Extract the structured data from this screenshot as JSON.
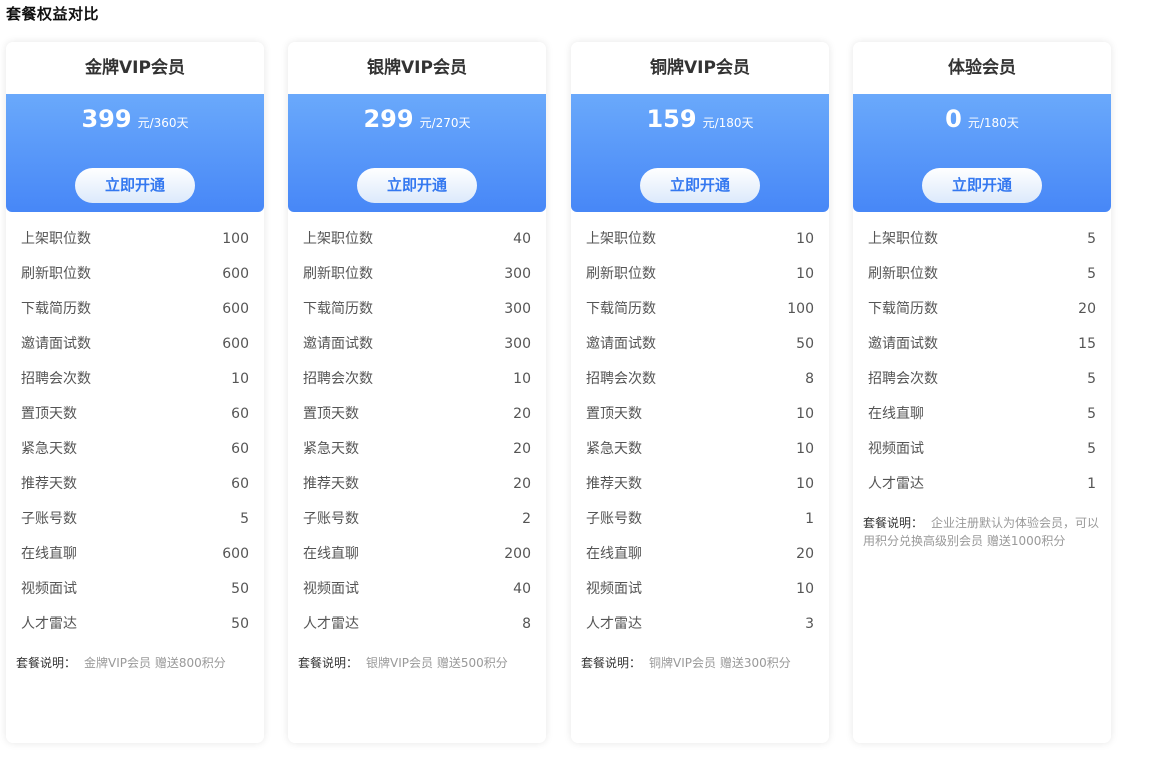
{
  "page_title": "套餐权益对比",
  "plans": [
    {
      "name": "金牌VIP会员",
      "price": "399",
      "unit": "元/360天",
      "button": "立即开通",
      "features": [
        {
          "label": "上架职位数",
          "value": "100"
        },
        {
          "label": "刷新职位数",
          "value": "600"
        },
        {
          "label": "下载简历数",
          "value": "600"
        },
        {
          "label": "邀请面试数",
          "value": "600"
        },
        {
          "label": "招聘会次数",
          "value": "10"
        },
        {
          "label": "置顶天数",
          "value": "60"
        },
        {
          "label": "紧急天数",
          "value": "60"
        },
        {
          "label": "推荐天数",
          "value": "60"
        },
        {
          "label": "子账号数",
          "value": "5"
        },
        {
          "label": "在线直聊",
          "value": "600"
        },
        {
          "label": "视频面试",
          "value": "50"
        },
        {
          "label": "人才雷达",
          "value": "50"
        }
      ],
      "note_label": "套餐说明：",
      "note_text": "金牌VIP会员 赠送800积分"
    },
    {
      "name": "银牌VIP会员",
      "price": "299",
      "unit": "元/270天",
      "button": "立即开通",
      "features": [
        {
          "label": "上架职位数",
          "value": "40"
        },
        {
          "label": "刷新职位数",
          "value": "300"
        },
        {
          "label": "下载简历数",
          "value": "300"
        },
        {
          "label": "邀请面试数",
          "value": "300"
        },
        {
          "label": "招聘会次数",
          "value": "10"
        },
        {
          "label": "置顶天数",
          "value": "20"
        },
        {
          "label": "紧急天数",
          "value": "20"
        },
        {
          "label": "推荐天数",
          "value": "20"
        },
        {
          "label": "子账号数",
          "value": "2"
        },
        {
          "label": "在线直聊",
          "value": "200"
        },
        {
          "label": "视频面试",
          "value": "40"
        },
        {
          "label": "人才雷达",
          "value": "8"
        }
      ],
      "note_label": "套餐说明：",
      "note_text": "银牌VIP会员 赠送500积分"
    },
    {
      "name": "铜牌VIP会员",
      "price": "159",
      "unit": "元/180天",
      "button": "立即开通",
      "features": [
        {
          "label": "上架职位数",
          "value": "10"
        },
        {
          "label": "刷新职位数",
          "value": "10"
        },
        {
          "label": "下载简历数",
          "value": "100"
        },
        {
          "label": "邀请面试数",
          "value": "50"
        },
        {
          "label": "招聘会次数",
          "value": "8"
        },
        {
          "label": "置顶天数",
          "value": "10"
        },
        {
          "label": "紧急天数",
          "value": "10"
        },
        {
          "label": "推荐天数",
          "value": "10"
        },
        {
          "label": "子账号数",
          "value": "1"
        },
        {
          "label": "在线直聊",
          "value": "20"
        },
        {
          "label": "视频面试",
          "value": "10"
        },
        {
          "label": "人才雷达",
          "value": "3"
        }
      ],
      "note_label": "套餐说明：",
      "note_text": "铜牌VIP会员 赠送300积分"
    },
    {
      "name": "体验会员",
      "price": "0",
      "unit": "元/180天",
      "button": "立即开通",
      "features": [
        {
          "label": "上架职位数",
          "value": "5"
        },
        {
          "label": "刷新职位数",
          "value": "5"
        },
        {
          "label": "下载简历数",
          "value": "20"
        },
        {
          "label": "邀请面试数",
          "value": "15"
        },
        {
          "label": "招聘会次数",
          "value": "5"
        },
        {
          "label": "在线直聊",
          "value": "5"
        },
        {
          "label": "视频面试",
          "value": "5"
        },
        {
          "label": "人才雷达",
          "value": "1"
        }
      ],
      "note_label": "套餐说明：",
      "note_text": "企业注册默认为体验会员，可以用积分兑换高级别会员 赠送1000积分"
    }
  ]
}
